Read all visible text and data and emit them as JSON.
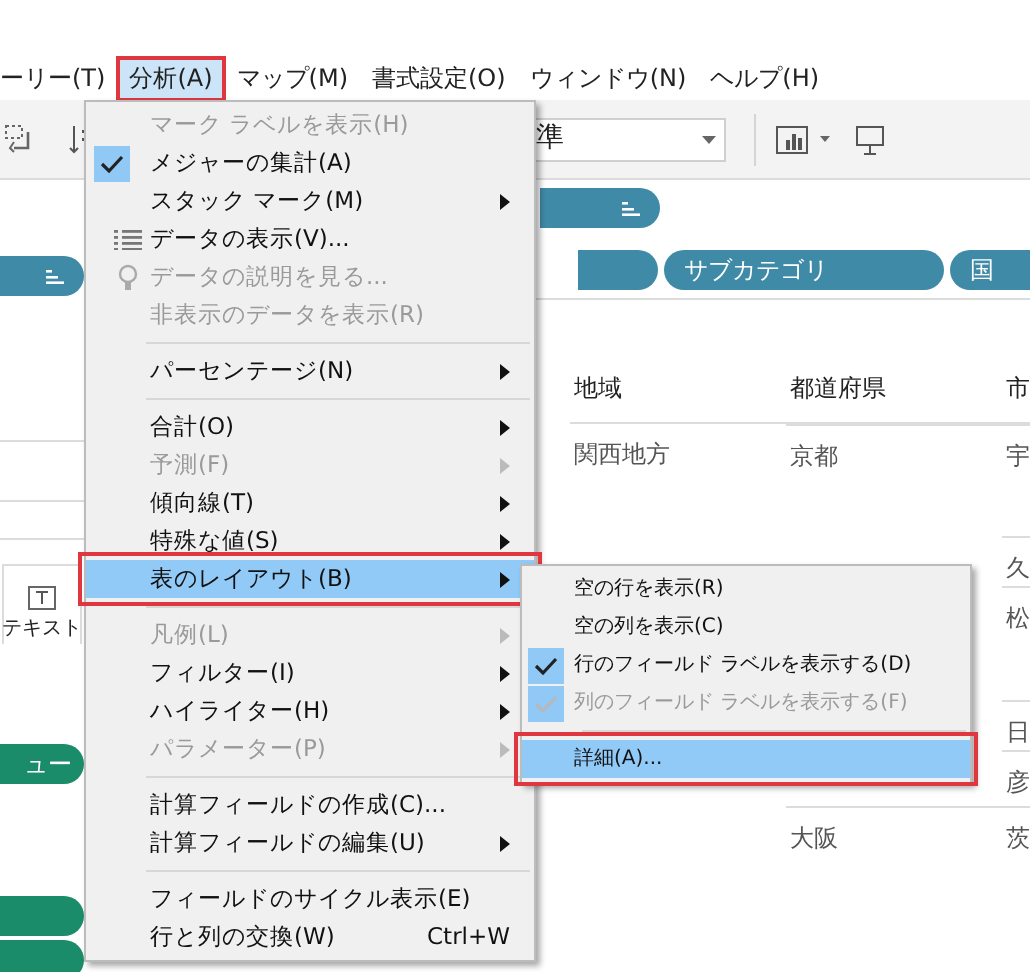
{
  "menubar": [
    {
      "label": "ーリー(T)",
      "selected": false
    },
    {
      "label": "分析(A)",
      "selected": true
    },
    {
      "label": "マップ(M)",
      "selected": false
    },
    {
      "label": "書式設定(O)",
      "selected": false
    },
    {
      "label": "ウィンドウ(N)",
      "selected": false
    },
    {
      "label": "ヘルプ(H)",
      "selected": false
    }
  ],
  "toolbar": {
    "dropdown_value": "準"
  },
  "shelves": {
    "pills": [
      "サブカテゴリ",
      "国"
    ]
  },
  "sidebar": {
    "marks_card_label": "テキスト",
    "pill": "ュー"
  },
  "table": {
    "columns": [
      "地域",
      "都道府県",
      "市"
    ],
    "rows": [
      {
        "region": "関西地方",
        "prefecture": "京都",
        "city": "宇"
      },
      {
        "city": "久"
      },
      {
        "city": "松"
      },
      {
        "city": "日"
      },
      {
        "city": "彦"
      },
      {
        "prefecture": "大阪",
        "city": "茨"
      }
    ]
  },
  "menu": [
    {
      "kind": "item",
      "label": "マーク ラベルを表示(H)",
      "disabled": true,
      "checked": false,
      "submenu": false,
      "selected": false
    },
    {
      "kind": "item",
      "label": "メジャーの集計(A)",
      "disabled": false,
      "checked": true,
      "submenu": false,
      "selected": false
    },
    {
      "kind": "item",
      "label": "スタック マーク(M)",
      "disabled": false,
      "checked": false,
      "submenu": true,
      "selected": false
    },
    {
      "kind": "item",
      "label": "データの表示(V)...",
      "disabled": false,
      "checked": false,
      "submenu": false,
      "selected": false
    },
    {
      "kind": "item",
      "label": "データの説明を見る...",
      "disabled": true,
      "checked": false,
      "submenu": false,
      "selected": false
    },
    {
      "kind": "item",
      "label": "非表示のデータを表示(R)",
      "disabled": true,
      "checked": false,
      "submenu": false,
      "selected": false
    },
    {
      "kind": "separator"
    },
    {
      "kind": "item",
      "label": "パーセンテージ(N)",
      "disabled": false,
      "checked": false,
      "submenu": true,
      "selected": false
    },
    {
      "kind": "separator"
    },
    {
      "kind": "item",
      "label": "合計(O)",
      "disabled": false,
      "checked": false,
      "submenu": true,
      "selected": false
    },
    {
      "kind": "item",
      "label": "予測(F)",
      "disabled": true,
      "checked": false,
      "submenu": true,
      "selected": false
    },
    {
      "kind": "item",
      "label": "傾向線(T)",
      "disabled": false,
      "checked": false,
      "submenu": true,
      "selected": false
    },
    {
      "kind": "item",
      "label": "特殊な値(S)",
      "disabled": false,
      "checked": false,
      "submenu": true,
      "selected": false
    },
    {
      "kind": "item",
      "label": "表のレイアウト(B)",
      "disabled": false,
      "checked": false,
      "submenu": true,
      "selected": true
    },
    {
      "kind": "separator"
    },
    {
      "kind": "item",
      "label": "凡例(L)",
      "disabled": true,
      "checked": false,
      "submenu": true,
      "selected": false
    },
    {
      "kind": "item",
      "label": "フィルター(I)",
      "disabled": false,
      "checked": false,
      "submenu": true,
      "selected": false
    },
    {
      "kind": "item",
      "label": "ハイライター(H)",
      "disabled": false,
      "checked": false,
      "submenu": true,
      "selected": false
    },
    {
      "kind": "item",
      "label": "パラメーター(P)",
      "disabled": true,
      "checked": false,
      "submenu": true,
      "selected": false
    },
    {
      "kind": "separator"
    },
    {
      "kind": "item",
      "label": "計算フィールドの作成(C)...",
      "disabled": false,
      "checked": false,
      "submenu": false,
      "selected": false
    },
    {
      "kind": "item",
      "label": "計算フィールドの編集(U)",
      "disabled": false,
      "checked": false,
      "submenu": true,
      "selected": false
    },
    {
      "kind": "separator"
    },
    {
      "kind": "item",
      "label": "フィールドのサイクル表示(E)",
      "disabled": false,
      "checked": false,
      "submenu": false,
      "selected": false
    },
    {
      "kind": "item",
      "label": "行と列の交換(W)",
      "disabled": false,
      "checked": false,
      "submenu": false,
      "selected": false,
      "shortcut": "Ctrl+W"
    }
  ],
  "submenu": [
    {
      "kind": "item",
      "label": "空の行を表示(R)",
      "disabled": false,
      "checked": false,
      "selected": false
    },
    {
      "kind": "item",
      "label": "空の列を表示(C)",
      "disabled": false,
      "checked": false,
      "selected": false
    },
    {
      "kind": "item",
      "label": "行のフィールド ラベルを表示する(D)",
      "disabled": false,
      "checked": true,
      "selected": false
    },
    {
      "kind": "item",
      "label": "列のフィールド ラベルを表示する(F)",
      "disabled": true,
      "checked": true,
      "selected": false
    },
    {
      "kind": "separator"
    },
    {
      "kind": "item",
      "label": "詳細(A)...",
      "disabled": false,
      "checked": false,
      "selected": true
    }
  ]
}
